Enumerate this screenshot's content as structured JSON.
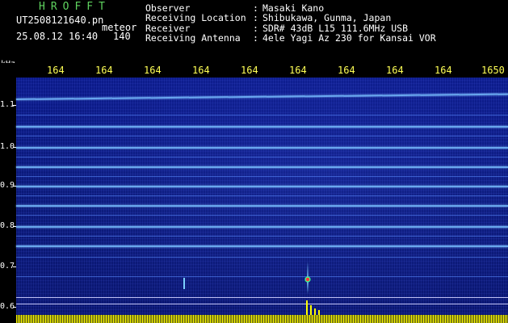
{
  "header": {
    "app_title": "HROFFT",
    "filename": "UT2508121640.pn",
    "kind": "meteor",
    "timestamp": "25.08.12 16:40",
    "count": "140",
    "info": [
      {
        "key": "Observer",
        "value": "Masaki Kano"
      },
      {
        "key": "Receiving Location",
        "value": "Shibukawa, Gunma, Japan"
      },
      {
        "key": "Receiver",
        "value": "SDR# 43dB L15 111.6MHz USB"
      },
      {
        "key": "Receiving Antenna",
        "value": "4ele Yagi Az 230 for Kansai VOR"
      }
    ],
    "separator": ":"
  },
  "time_scale": {
    "labels": [
      "164",
      "164",
      "164",
      "164",
      "164",
      "164",
      "164",
      "164",
      "164",
      "1650"
    ]
  },
  "y_axis": {
    "unit": "kHz",
    "labels": [
      "1.1",
      "1.0",
      "0.9",
      "0.8",
      "0.7",
      "0.6"
    ]
  },
  "colors": {
    "title": "#5fd35f",
    "scale_text": "#ffff55",
    "background": "#0a1978",
    "trace": "#78beff",
    "strip": "#ffff00"
  }
}
